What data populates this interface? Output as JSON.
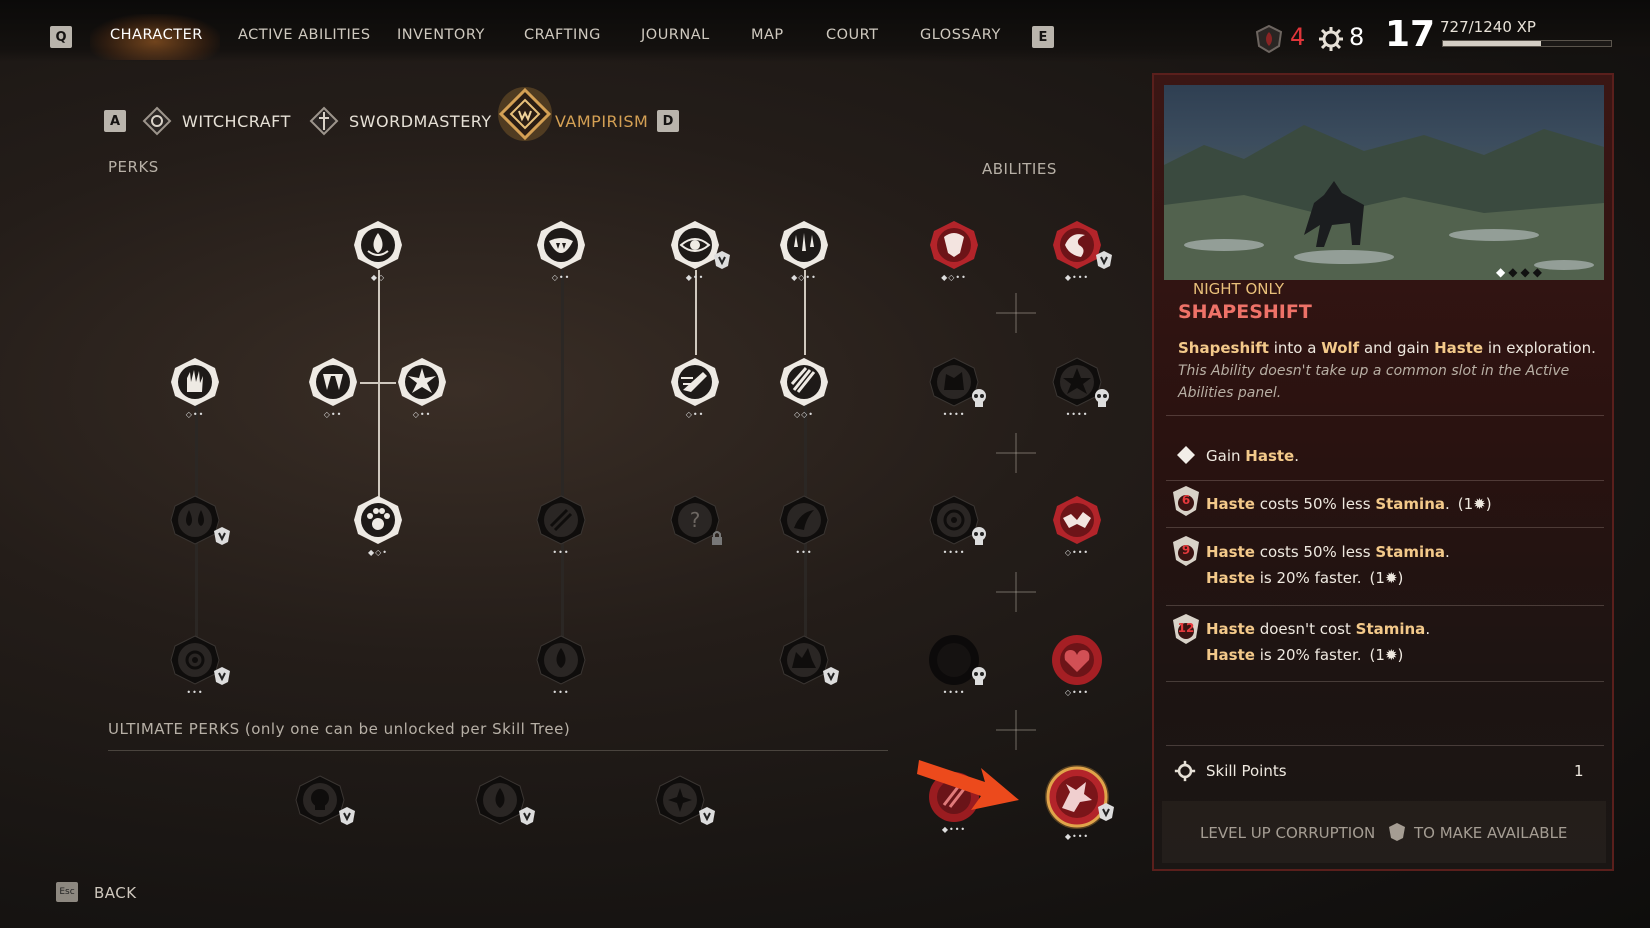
{
  "nav": {
    "left_key": "Q",
    "right_key": "E",
    "tabs": [
      {
        "label": "CHARACTER",
        "active": true
      },
      {
        "label": "ACTIVE ABILITIES"
      },
      {
        "label": "INVENTORY"
      },
      {
        "label": "CRAFTING"
      },
      {
        "label": "JOURNAL"
      },
      {
        "label": "MAP"
      },
      {
        "label": "COURT"
      },
      {
        "label": "GLOSSARY"
      }
    ]
  },
  "stats": {
    "corruption": "4",
    "skill_points": "8",
    "level": "17",
    "xp_text": "727/1240 XP",
    "xp_progress": 0.586
  },
  "skilltabs": {
    "left_key": "A",
    "right_key": "D",
    "tabs": [
      {
        "label": "WITCHCRAFT"
      },
      {
        "label": "SWORDMASTERY"
      },
      {
        "label": "VAMPIRISM",
        "active": true
      }
    ]
  },
  "tree": {
    "perks_label": "PERKS",
    "abilities_label": "ABILITIES",
    "ultimate_label": "ULTIMATE PERKS (only one can be unlocked per Skill Tree)"
  },
  "detail": {
    "tag": "NIGHT ONLY",
    "title": "SHAPESHIFT",
    "desc": {
      "w1": "Shapeshift",
      "t1": " into a ",
      "w2": "Wolf",
      "t2": " and gain ",
      "w3": "Haste",
      "t3": " in exploration."
    },
    "note_line1": "This Ability doesn't take up a common slot in the Active",
    "note_line2": "Abilities panel.",
    "upgrades": {
      "u0": {
        "t1": "Gain ",
        "w1": "Haste",
        "t2": "."
      },
      "u1": {
        "level": "6",
        "w1": "Haste",
        "t1": " costs 50% less ",
        "w2": "Stamina",
        "t2": ".",
        "cost": "(1",
        "cost_end": ")"
      },
      "u2": {
        "level": "9",
        "w1": "Haste",
        "t1": " costs 50% less ",
        "w2": "Stamina",
        "t2": ".",
        "w3": "Haste",
        "t3": " is 20% faster.",
        "cost": "(1",
        "cost_end": ")"
      },
      "u3": {
        "level": "12",
        "w1": "Haste",
        "t1": " doesn't cost ",
        "w2": "Stamina",
        "t2": ".",
        "w3": "Haste",
        "t3": " is 20% faster.",
        "cost": "(1",
        "cost_end": ")"
      }
    },
    "skill_points_label": "Skill Points",
    "skill_points_value": "1",
    "footer_left": "LEVEL UP CORRUPTION",
    "footer_right": "TO MAKE AVAILABLE"
  },
  "back": {
    "key": "Esc",
    "label": "BACK"
  },
  "colors": {
    "accent": "#d4a054",
    "panel_red": "#3b1614",
    "ability_red": "#b3242a",
    "arrow": "#ec4a1c"
  }
}
